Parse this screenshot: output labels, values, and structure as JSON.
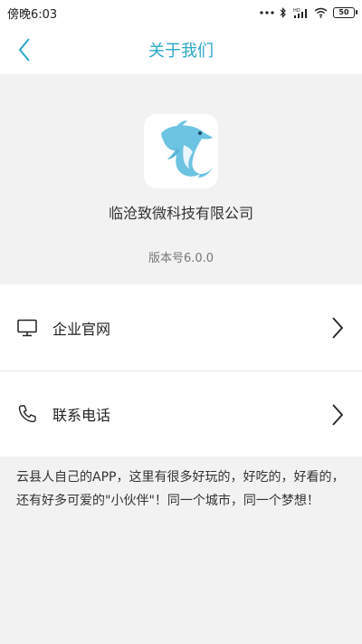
{
  "status_bar": {
    "time": "傍晚6:03",
    "battery": "50",
    "icons": [
      "more-dots-icon",
      "bluetooth-icon",
      "hd-signal-icon",
      "wifi-icon",
      "battery-icon"
    ]
  },
  "navbar": {
    "title": "关于我们",
    "back_icon": "chevron-left-icon"
  },
  "app_info": {
    "company_name": "临沧致微科技有限公司",
    "version": "版本号6.0.0",
    "logo": "dolphin-logo"
  },
  "menu": {
    "items": [
      {
        "label": "企业官网",
        "icon": "monitor-icon"
      },
      {
        "label": "联系电话",
        "icon": "phone-icon"
      }
    ]
  },
  "description": "云县人自己的APP，这里有很多好玩的，好吃的，好看的，还有好多可爱的\"小伙伴\"！同一个城市，同一个梦想！",
  "colors": {
    "accent": "#2aa7c8",
    "background": "#f2f2f2",
    "logo_blue": "#6cc3e2"
  }
}
